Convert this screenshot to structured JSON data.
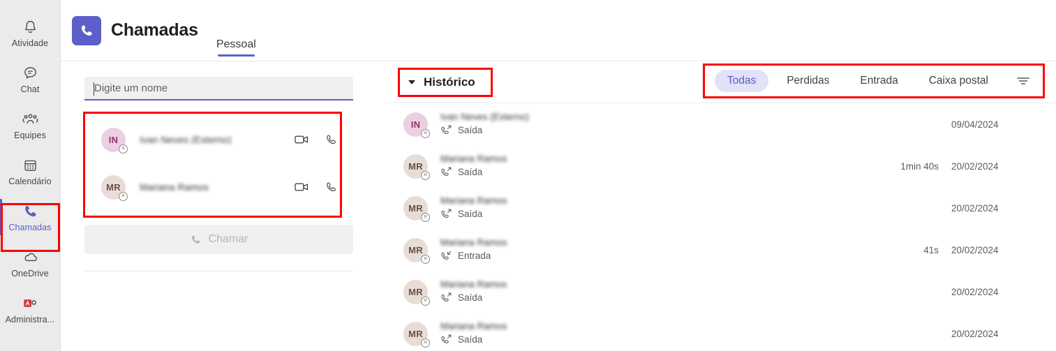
{
  "app": {
    "title": "Chamadas",
    "badge_icon": "phone-icon",
    "tab": "Pessoal"
  },
  "sidebar": {
    "items": [
      {
        "label": "Atividade",
        "icon": "bell-icon",
        "active": false
      },
      {
        "label": "Chat",
        "icon": "chat-icon",
        "active": false
      },
      {
        "label": "Equipes",
        "icon": "people-icon",
        "active": false
      },
      {
        "label": "Calendário",
        "icon": "calendar-icon",
        "active": false
      },
      {
        "label": "Chamadas",
        "icon": "phone-icon",
        "active": true
      },
      {
        "label": "OneDrive",
        "icon": "cloud-icon",
        "active": false
      },
      {
        "label": "Administra...",
        "icon": "admin-icon",
        "active": false
      }
    ],
    "accent": "#5b5fc7",
    "highlight": "#ff0000"
  },
  "dial": {
    "search_placeholder": "Digite um nome",
    "search_value": "",
    "contacts": [
      {
        "initials": "IN",
        "avatar_color": "#eccfe2",
        "initials_color": "#8c3a68",
        "name": "Ivan Neves (Externo)",
        "presence": "offline",
        "video_icon": "video-icon",
        "call_icon": "phone-icon"
      },
      {
        "initials": "MR",
        "avatar_color": "#e8dcd6",
        "initials_color": "#6b4f45",
        "name": "Mariana Ramos",
        "presence": "offline",
        "video_icon": "video-icon",
        "call_icon": "phone-icon"
      }
    ],
    "call_button": "Chamar",
    "call_button_icon": "phone-icon"
  },
  "history": {
    "title": "Histórico",
    "caret_icon": "chevron-down-icon",
    "filter_icon": "filter-icon",
    "tabs": [
      {
        "label": "Todas",
        "selected": true
      },
      {
        "label": "Perdidas",
        "selected": false
      },
      {
        "label": "Entrada",
        "selected": false
      },
      {
        "label": "Caixa postal",
        "selected": false
      }
    ],
    "rows": [
      {
        "initials": "IN",
        "avatar_color": "#eccfe2",
        "initials_color": "#8c3a68",
        "name": "Ivan Neves (Externo)",
        "direction": "Saída",
        "direction_icon": "call-outgoing-icon",
        "duration": "",
        "date": "09/04/2024"
      },
      {
        "initials": "MR",
        "avatar_color": "#e8dcd6",
        "initials_color": "#6b4f45",
        "name": "Mariana Ramos",
        "direction": "Saída",
        "direction_icon": "call-outgoing-icon",
        "duration": "1min 40s",
        "date": "20/02/2024"
      },
      {
        "initials": "MR",
        "avatar_color": "#e8dcd6",
        "initials_color": "#6b4f45",
        "name": "Mariana Ramos",
        "direction": "Saída",
        "direction_icon": "call-outgoing-icon",
        "duration": "",
        "date": "20/02/2024"
      },
      {
        "initials": "MR",
        "avatar_color": "#e8dcd6",
        "initials_color": "#6b4f45",
        "name": "Mariana Ramos",
        "direction": "Entrada",
        "direction_icon": "call-incoming-icon",
        "duration": "41s",
        "date": "20/02/2024"
      },
      {
        "initials": "MR",
        "avatar_color": "#e8dcd6",
        "initials_color": "#6b4f45",
        "name": "Mariana Ramos",
        "direction": "Saída",
        "direction_icon": "call-outgoing-icon",
        "duration": "",
        "date": "20/02/2024"
      },
      {
        "initials": "MR",
        "avatar_color": "#e8dcd6",
        "initials_color": "#6b4f45",
        "name": "Mariana Ramos",
        "direction": "Saída",
        "direction_icon": "call-outgoing-icon",
        "duration": "",
        "date": "20/02/2024"
      }
    ]
  }
}
